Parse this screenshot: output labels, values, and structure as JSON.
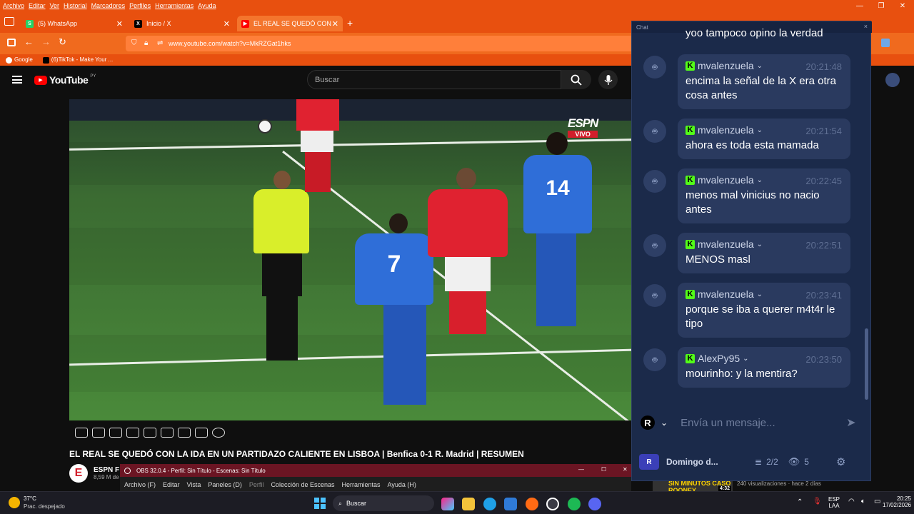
{
  "browser": {
    "menu": [
      "Archivo",
      "Editar",
      "Ver",
      "Historial",
      "Marcadores",
      "Perfiles",
      "Herramientas",
      "Ayuda"
    ],
    "tabs": [
      {
        "label": "(5) WhatsApp",
        "icon": "whatsapp-icon"
      },
      {
        "label": "Inicio / X",
        "icon": "x-icon"
      },
      {
        "label": "EL REAL SE QUEDÓ CON LA IDA",
        "icon": "youtube-icon"
      }
    ],
    "url": "www.youtube.com/watch?v=MkRZGat1hks",
    "bookmarks": [
      "Google",
      "(6)TikTok - Make Your ..."
    ]
  },
  "youtube": {
    "logo": "YouTube",
    "region": "PY",
    "search_placeholder": "Buscar",
    "video_title": "EL REAL SE QUEDÓ CON LA IDA EN UN PARTIDAZO CALIENTE EN LISBOA | Benfica 0-1 R. Madrid | RESUMEN",
    "channel": "ESPN F",
    "subscribers": "8,59 M de",
    "overlay_brand": "ESPN",
    "overlay_live": "VIVO",
    "sidebar_rec_title": "SIN MINUTOS CASO ROONEY",
    "sidebar_rec_duration": "4:32",
    "sidebar_rec_meta": "240 visualizaciones · hace 2 días"
  },
  "chat": {
    "header": "Chat",
    "partial_top": "yoo tampoco opino la verdad",
    "messages": [
      {
        "user": "mvalenzuela",
        "time": "20:21:48",
        "text": "encima la señal de la X era otra cosa antes"
      },
      {
        "user": "mvalenzuela",
        "time": "20:21:54",
        "text": "ahora es toda esta mamada"
      },
      {
        "user": "mvalenzuela",
        "time": "20:22:45",
        "text": "menos mal vinicius no nacio antes"
      },
      {
        "user": "mvalenzuela",
        "time": "20:22:51",
        "text": "MENOS masl"
      },
      {
        "user": "mvalenzuela",
        "time": "20:23:41",
        "text": "porque se iba a querer m4t4r le tipo"
      },
      {
        "user": "AlexPy95",
        "time": "20:23:50",
        "text": "mourinho: y la mentira?"
      }
    ],
    "input_placeholder": "Envía un mensaje...",
    "channel_initial": "R",
    "footer_channel": "Domingo d...",
    "footer_count": "2/2",
    "viewers": "5"
  },
  "obs": {
    "title": "OBS 32.0.4 - Perfil: Sin Título - Escenas: Sin Título",
    "menu": [
      "Archivo (F)",
      "Editar",
      "Vista",
      "Paneles (D)",
      "Perfil",
      "Colección de Escenas",
      "Herramientas",
      "Ayuda (H)"
    ]
  },
  "taskbar": {
    "weather_temp": "37°C",
    "weather_desc": "Prac. despejado",
    "search_label": "Buscar",
    "lang": "ESP",
    "lang2": "LAA",
    "time": "20:25",
    "date": "17/02/2026"
  },
  "colors": {
    "browser_orange": "#e8500f",
    "kick_green": "#53fc18",
    "chat_bg": "#1b2a4a",
    "obs_red": "#6b1523"
  }
}
